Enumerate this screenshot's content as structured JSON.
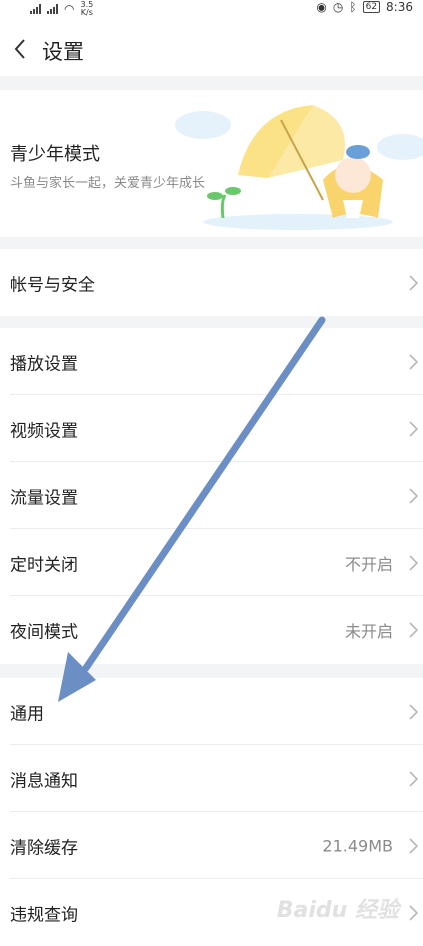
{
  "status_bar": {
    "speed_value": "3.5",
    "speed_unit": "K/s",
    "battery": "62",
    "time": "8:36"
  },
  "header": {
    "title": "设置",
    "back_icon": "chevron-left-icon"
  },
  "youth_mode": {
    "title": "青少年模式",
    "subtitle": "斗鱼与家长一起，关爱青少年成长"
  },
  "groups": [
    {
      "rows": [
        {
          "label": "帐号与安全",
          "value": ""
        }
      ]
    },
    {
      "rows": [
        {
          "label": "播放设置",
          "value": ""
        },
        {
          "label": "视频设置",
          "value": ""
        },
        {
          "label": "流量设置",
          "value": ""
        },
        {
          "label": "定时关闭",
          "value": "不开启"
        },
        {
          "label": "夜间模式",
          "value": "未开启"
        }
      ]
    },
    {
      "rows": [
        {
          "label": "通用",
          "value": ""
        },
        {
          "label": "消息通知",
          "value": ""
        },
        {
          "label": "清除缓存",
          "value": "21.49MB"
        },
        {
          "label": "违规查询",
          "value": ""
        }
      ]
    }
  ],
  "annotation": {
    "arrow_color": "#6b8fc4"
  },
  "watermark": "Baidu 经验",
  "colors": {
    "background": "#ffffff",
    "section_gap": "#f3f4f5",
    "text": "#222222",
    "secondary_text": "#8a8a8a"
  }
}
